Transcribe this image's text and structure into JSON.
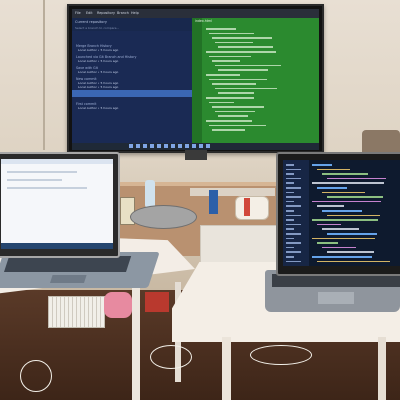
{
  "photo": {
    "description_items": [
      "monitor",
      "laptop-left",
      "laptop-right",
      "table-left",
      "table-right"
    ]
  },
  "monitor": {
    "menu_items": [
      "File",
      "Edit",
      "Repository",
      "Branch",
      "Help"
    ],
    "sidebar_title": "Current repository",
    "sidebar_search": "Select a branch to compare...",
    "sections": [
      {
        "title": "Merge Branch History",
        "items": [
          "Local Author • 5 hours ago"
        ]
      },
      {
        "title": "Launched via Git Branch and History",
        "items": [
          "Local Author • 5 hours ago"
        ]
      },
      {
        "title": "Save with Git",
        "items": [
          "Local Author • 5 hours ago"
        ]
      },
      {
        "title": "New commit",
        "items": [
          "Local Author • 5 hours ago",
          "Local Author • 5 hours ago"
        ]
      },
      {
        "title": "First commit",
        "items": [
          "Local Author • 5 hours ago"
        ]
      }
    ],
    "code_tab": "index.html",
    "accent_color": "#2b8a2f"
  }
}
